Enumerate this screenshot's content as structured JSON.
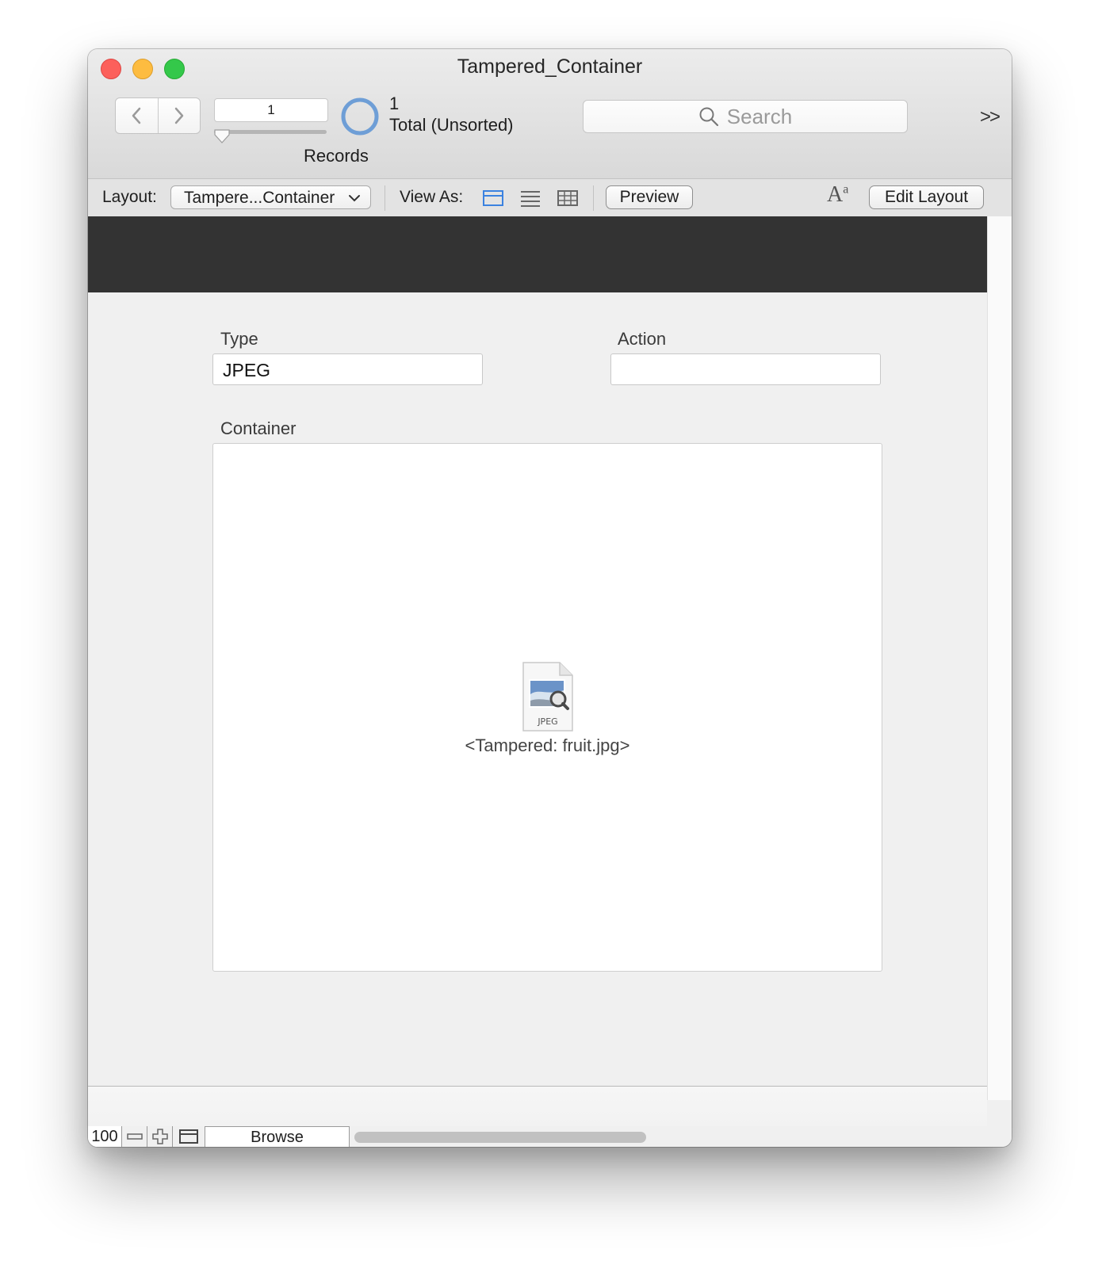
{
  "window": {
    "title": "Tampered_Container"
  },
  "toolbar": {
    "record_number": "1",
    "records_label": "Records",
    "found_count": "1",
    "found_status": "Total (Unsorted)",
    "search_placeholder": "Search",
    "overflow_label": ">>"
  },
  "layout_bar": {
    "layout_label": "Layout:",
    "layout_value": "Tampere...Container",
    "view_as_label": "View As:",
    "view_modes": [
      "form-view-icon",
      "list-view-icon",
      "table-view-icon"
    ],
    "active_view": "form",
    "preview_label": "Preview",
    "font_icon_text": "A",
    "font_icon_sup": "a",
    "edit_layout_label": "Edit Layout",
    "accent_color": "#3b82e0"
  },
  "form": {
    "type_label": "Type",
    "type_value": "JPEG",
    "action_label": "Action",
    "action_value": "",
    "container_label": "Container",
    "file_badge": "JPEG",
    "file_caption": "<Tampered: fruit.jpg>"
  },
  "statusbar": {
    "zoom": "100",
    "mode": "Browse"
  }
}
